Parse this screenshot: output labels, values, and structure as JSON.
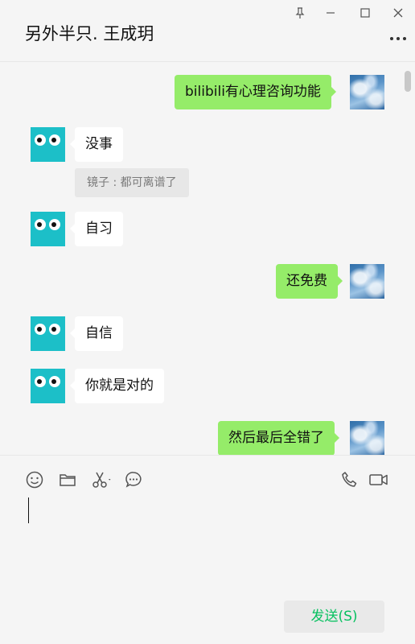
{
  "window": {
    "title": "另外半只. 王成玥"
  },
  "icons": {
    "pin": "pin-icon",
    "minimize": "minimize-icon",
    "maximize": "maximize-icon",
    "close": "close-icon",
    "more": "more-icon",
    "emoji": "emoji-icon",
    "folder": "folder-icon",
    "scissors": "scissors-icon",
    "chat_history": "chat-history-icon",
    "voice_call": "phone-icon",
    "video_call": "video-call-icon"
  },
  "colors": {
    "sent_bubble": "#95ec69",
    "received_bubble": "#ffffff",
    "friend_avatar": "#1cbfc8",
    "send_text": "#07c160",
    "background": "#f5f5f5"
  },
  "messages": [
    {
      "side": "right",
      "text": "bilibili有心理咨询功能"
    },
    {
      "side": "left",
      "text": "没事",
      "quote": "镜子 : 都可离谱了"
    },
    {
      "side": "left",
      "text": "自习"
    },
    {
      "side": "right",
      "text": "还免费"
    },
    {
      "side": "left",
      "text": "自信"
    },
    {
      "side": "left",
      "text": "你就是对的"
    },
    {
      "side": "right",
      "text": "然后最后全错了"
    }
  ],
  "composer": {
    "value": "",
    "send_label": "发送(S)"
  }
}
